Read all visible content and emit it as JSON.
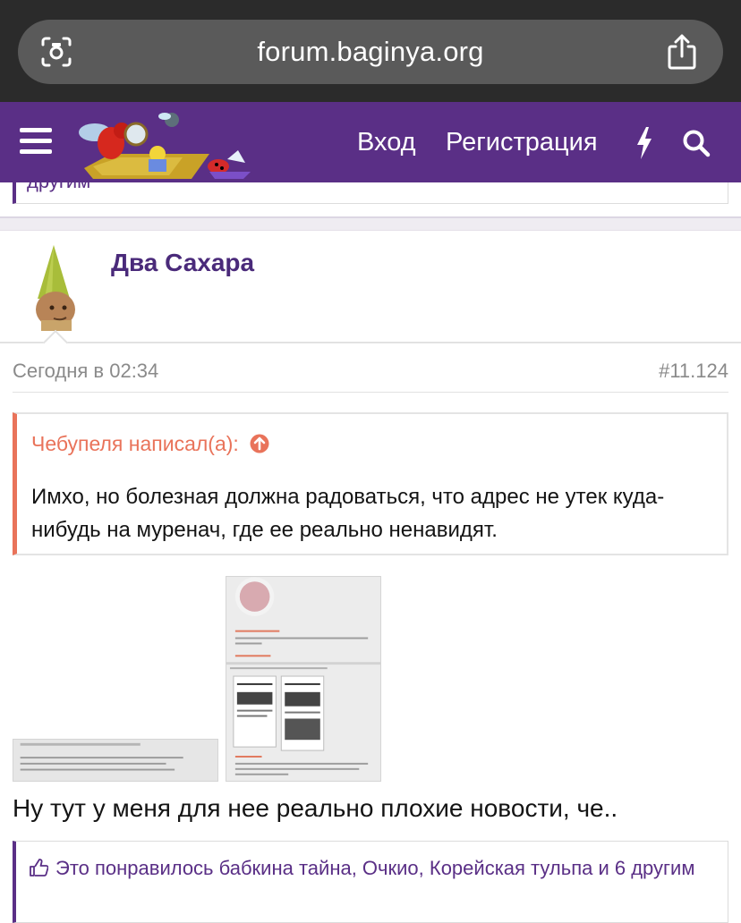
{
  "browser": {
    "url": "forum.baginya.org",
    "icons": [
      "camera-icon",
      "share-icon"
    ]
  },
  "header": {
    "nav_login": "Вход",
    "nav_register": "Регистрация",
    "icons": [
      "menu-icon",
      "bolt-icon",
      "search-icon"
    ],
    "brand_color": "#5a2f86"
  },
  "previous_post": {
    "likes_tail": "другим"
  },
  "post": {
    "author": "Два Сахара",
    "date": "Сегодня в 02:34",
    "number": "#11.124",
    "quote": {
      "author_line": "Чебупеля написал(а):",
      "text": "Имхо, но болезная должна радоваться, что адрес не утек куда-нибудь на муренач, где ее реально ненавидят.",
      "accent_color": "#e9735a"
    },
    "text": "Ну тут у меня для нее реально плохие новости, че..",
    "likes": "Это понравилось бабкина тайна, Очкио, Корейская тульпа и 6 другим"
  }
}
